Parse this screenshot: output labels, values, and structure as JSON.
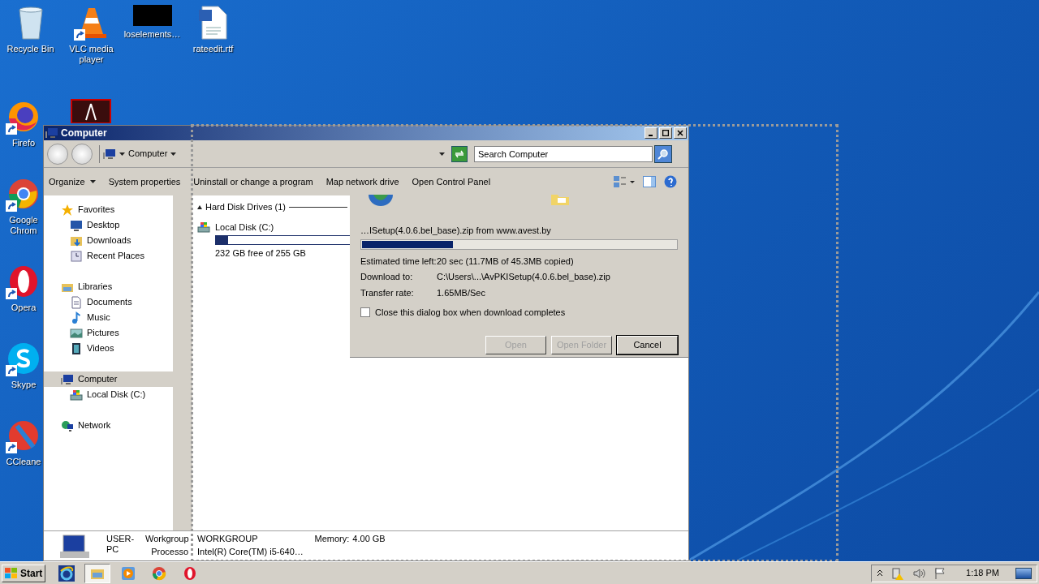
{
  "desktop_top": [
    {
      "label": "Recycle Bin",
      "kind": "recycle"
    },
    {
      "label": "VLC media player",
      "kind": "vlc",
      "shortcut": true
    },
    {
      "label": "loselements…",
      "kind": "black"
    },
    {
      "label": "rateedit.rtf",
      "kind": "doc"
    }
  ],
  "desktop_left": [
    {
      "label": "Firefo",
      "kind": "firefox",
      "shortcut": true
    },
    {
      "label": "Google Chrom",
      "kind": "chrome",
      "shortcut": true
    },
    {
      "label": "Opera",
      "kind": "opera",
      "shortcut": true
    },
    {
      "label": "Skype",
      "kind": "skype",
      "shortcut": true
    },
    {
      "label": "CCleane",
      "kind": "ccleaner",
      "shortcut": true
    }
  ],
  "desktop_partial": [
    {
      "kind": "pdf"
    }
  ],
  "explorer": {
    "title": "Computer",
    "address": "Computer",
    "search": {
      "placeholder": "Search Computer"
    },
    "toolbar": [
      {
        "label": "Organize",
        "menu": true
      },
      {
        "label": "System properties",
        "menu": false
      },
      {
        "label": "Uninstall or change a program",
        "menu": false
      },
      {
        "label": "Map network drive",
        "menu": false
      },
      {
        "label": "Open Control Panel",
        "menu": false
      }
    ],
    "nav": [
      {
        "label": "Favorites",
        "kind": "star",
        "selected": false,
        "children": [
          {
            "label": "Desktop",
            "kind": "desktop",
            "selected": false
          },
          {
            "label": "Downloads",
            "kind": "downloads",
            "selected": false
          },
          {
            "label": "Recent Places",
            "kind": "recent",
            "selected": false
          }
        ]
      },
      {
        "label": "Libraries",
        "kind": "library",
        "selected": false,
        "children": [
          {
            "label": "Documents",
            "kind": "documents",
            "selected": false
          },
          {
            "label": "Music",
            "kind": "music",
            "selected": false
          },
          {
            "label": "Pictures",
            "kind": "pictures",
            "selected": false
          },
          {
            "label": "Videos",
            "kind": "videos",
            "selected": false
          }
        ]
      },
      {
        "label": "Computer",
        "kind": "computer",
        "selected": true,
        "children": [
          {
            "label": "Local Disk (C:)",
            "kind": "disk",
            "selected": false
          }
        ]
      },
      {
        "label": "Network",
        "kind": "network",
        "selected": false
      }
    ],
    "group": "Hard Disk Drives (1)",
    "drives": [
      {
        "name": "Local Disk (C:)",
        "level": 0.09,
        "free": "232 GB free of 255 GB"
      }
    ],
    "details": {
      "name": "USER-PC",
      "rows": [
        [
          {
            "label": "Workgroup",
            "value": "WORKGROUP"
          },
          {
            "label": "Memory:",
            "value": "4.00 GB"
          }
        ],
        [
          {
            "label": "Processo",
            "value": "Intel(R) Core(TM) i5-640…"
          }
        ]
      ]
    }
  },
  "download": {
    "source": "…ISetup(4.0.6.bel_base).zip from www.avest.by",
    "level": 0.29,
    "fields": [
      {
        "label": "Estimated time left:",
        "value": "20 sec (11.7MB of 45.3MB copied)"
      },
      {
        "label": "Download to:",
        "value": "C:\\Users\\...\\AvPKISetup(4.0.6.bel_base).zip"
      },
      {
        "label": "Transfer rate:",
        "value": "1.65MB/Sec"
      }
    ],
    "close_when_done": {
      "label": "Close this dialog box when download completes",
      "checked": false
    },
    "buttons": [
      {
        "label": "Open",
        "disabled": true,
        "default": false
      },
      {
        "label": "Open Folder",
        "disabled": true,
        "default": false
      },
      {
        "label": "Cancel",
        "disabled": false,
        "default": true
      }
    ]
  },
  "taskbar": {
    "start": "Start",
    "apps": [
      {
        "kind": "ie",
        "selected": false
      },
      {
        "kind": "explorer",
        "selected": true
      },
      {
        "kind": "media",
        "selected": false
      },
      {
        "kind": "chrome",
        "selected": false
      },
      {
        "kind": "opera",
        "selected": false
      }
    ],
    "clock": "1:18 PM"
  }
}
